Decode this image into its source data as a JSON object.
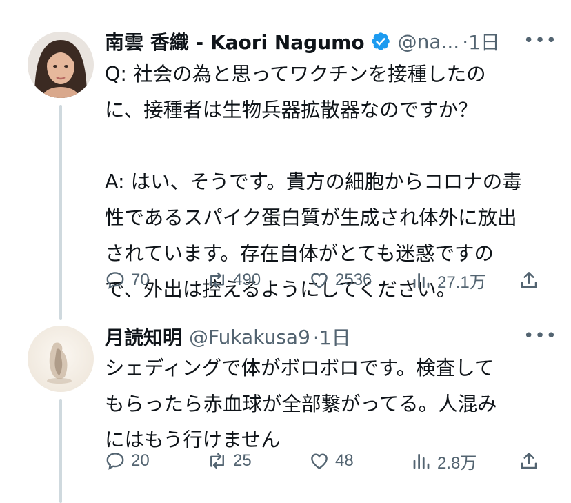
{
  "tweets": [
    {
      "name": "南雲 香織 - Kaori Nagumo",
      "handle": "@na...",
      "time": "·1日",
      "verified": true,
      "text": "Q: 社会の為と思ってワクチンを接種したの\nに、接種者は生物兵器拡散器なのですか？\n\nA: はい、そうです。貴方の細胞からコロナの毒\n性であるスパイク蛋白質が生成され体外に放出\nされています。存在自体がとても迷惑ですの\nで、外出は控えるようにしてください。",
      "replies": "70",
      "retweets": "490",
      "likes": "2536",
      "views": "27.1万"
    },
    {
      "name": "月読知明",
      "handle": "@Fukakusa9",
      "time": "·1日",
      "verified": false,
      "text": "シェディングで体がボロボロです。検査して\nもらったら赤血球が全部繋がってる。人混み\nにはもう行けません",
      "replies": "20",
      "retweets": "25",
      "likes": "48",
      "views": "2.8万"
    }
  ],
  "more_label": "•••",
  "colors": {
    "verified": "#1d9bf0",
    "secondary": "#536471",
    "thread": "#cfd9de"
  }
}
